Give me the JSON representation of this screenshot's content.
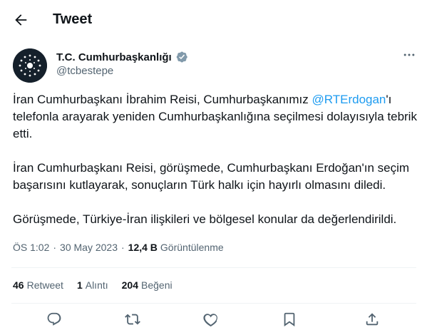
{
  "header": {
    "title": "Tweet",
    "back_icon": "arrow-left-icon"
  },
  "author": {
    "name": "T.C. Cumhurbaşkanlığı",
    "handle": "@tcbestepe",
    "verified_color": "#829aab",
    "avatar_bg": "#15202b"
  },
  "tweet": {
    "p1_before": "İran Cumhurbaşkanı İbrahim Reisi, Cumhurbaşkanımız ",
    "p1_mention": "@RTErdogan",
    "p1_after": "'ı telefonla arayarak yeniden Cumhurbaşkanlığına seçilmesi dolayısıyla tebrik etti.",
    "p2": "İran Cumhurbaşkanı Reisi, görüşmede, Cumhurbaşkanı Erdoğan'ın seçim başarısını kutlayarak, sonuçların Türk halkı için hayırlı olmasını diledi.",
    "p3": "Görüşmede, Türkiye-İran ilişkileri ve bölgesel konular da değerlendirildi."
  },
  "meta": {
    "time": "ÖS 1:02",
    "separator": "·",
    "date": "30 May 2023",
    "views_count": "12,4 B",
    "views_label": "Görüntülenme"
  },
  "stats": {
    "retweets_count": "46",
    "retweets_label": "Retweet",
    "quotes_count": "1",
    "quotes_label": "Alıntı",
    "likes_count": "204",
    "likes_label": "Beğeni"
  },
  "actions": [
    "reply-icon",
    "retweet-icon",
    "like-icon",
    "bookmark-icon",
    "share-icon"
  ],
  "colors": {
    "accent": "#1d9bf0",
    "secondary_text": "#536471",
    "divider": "#eff3f4"
  }
}
